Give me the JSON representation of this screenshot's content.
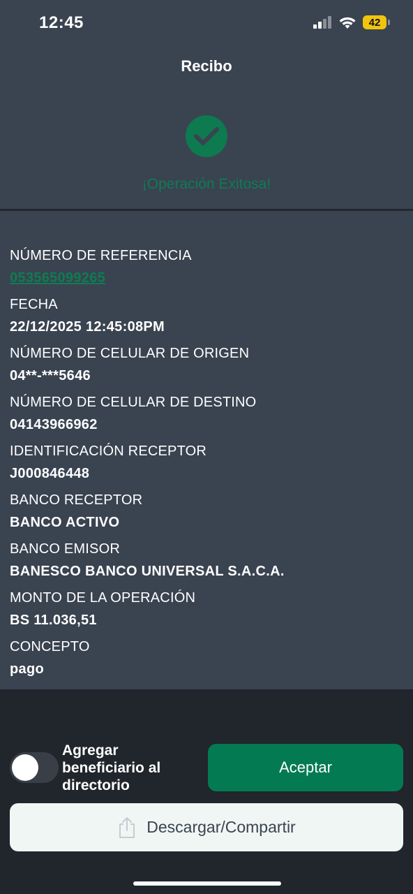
{
  "status_bar": {
    "time": "12:45",
    "battery": "42",
    "signal_icon": "cellular-signal-icon",
    "wifi_icon": "wifi-icon",
    "battery_color": "#f1c40f"
  },
  "header": {
    "title": "Recibo"
  },
  "result": {
    "icon": "check-circle-icon",
    "message": "¡Operación Exitosa!",
    "accent_color": "#0e7c52"
  },
  "fields": [
    {
      "label": "NÚMERO DE REFERENCIA",
      "value": "053565099265"
    },
    {
      "label": "FECHA",
      "value": "22/12/2025 12:45:08PM"
    },
    {
      "label": "NÚMERO DE CELULAR DE ORIGEN",
      "value": "04**-***5646"
    },
    {
      "label": "NÚMERO DE CELULAR DE DESTINO",
      "value": "04143966962"
    },
    {
      "label": "IDENTIFICACIÓN RECEPTOR",
      "value": "J000846448"
    },
    {
      "label": "BANCO RECEPTOR",
      "value": "BANCO ACTIVO"
    },
    {
      "label": "BANCO EMISOR",
      "value": "BANESCO BANCO UNIVERSAL S.A.C.A."
    },
    {
      "label": "MONTO DE LA OPERACIÓN",
      "value": "BS 11.036,51"
    },
    {
      "label": "CONCEPTO",
      "value": "pago"
    }
  ],
  "actions": {
    "toggle_label": "Agregar beneficiario al directorio",
    "toggle_on": false,
    "accept_label": "Aceptar",
    "share_label": "Descargar/Compartir",
    "share_icon": "share-icon",
    "accept_color": "#047a52"
  }
}
